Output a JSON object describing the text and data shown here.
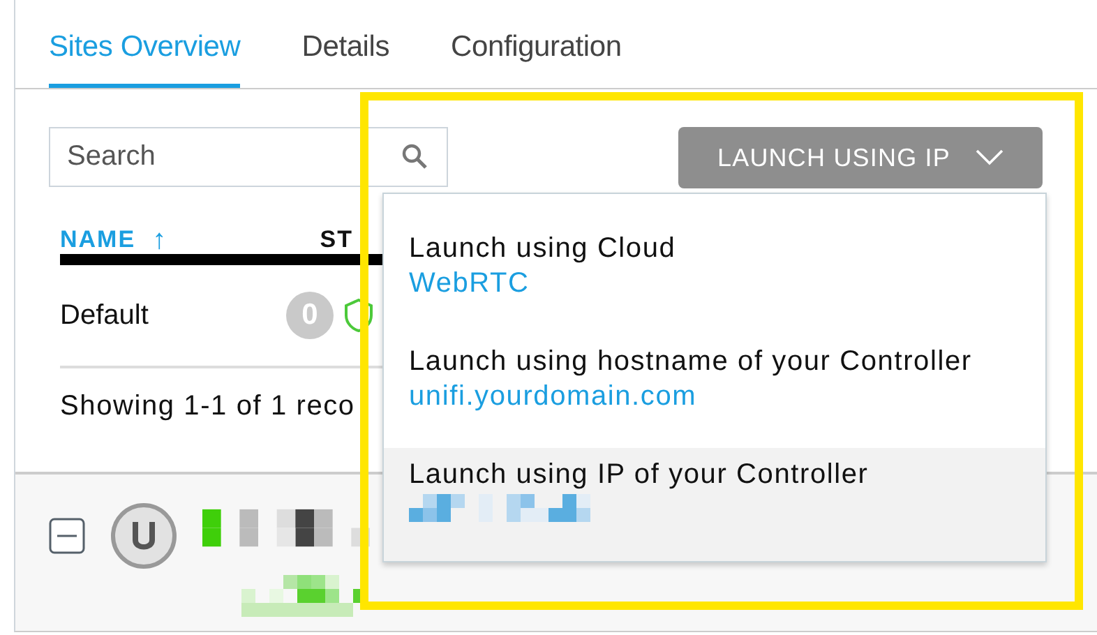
{
  "tabs": [
    {
      "label": "Sites Overview",
      "selected": true
    },
    {
      "label": "Details",
      "selected": false
    },
    {
      "label": "Configuration",
      "selected": false
    }
  ],
  "search": {
    "placeholder": "Search"
  },
  "table": {
    "columns": [
      {
        "label": "NAME",
        "sorted": true,
        "sort_arrow": "↑"
      },
      {
        "label": "ST",
        "sorted": false
      }
    ],
    "rows": [
      {
        "name": "Default",
        "count": "0"
      }
    ],
    "footer": "Showing 1-1 of 1 reco"
  },
  "launch_button": {
    "label": "LAUNCH USING IP"
  },
  "launch_menu": {
    "items": [
      {
        "title": "Launch using Cloud",
        "detail": "WebRTC",
        "selected": false
      },
      {
        "title": "Launch using hostname of your Controller",
        "detail": "unifi.yourdomain.com",
        "selected": false
      },
      {
        "title": "Launch using IP of your Controller",
        "redacted": true,
        "selected": true
      }
    ]
  }
}
